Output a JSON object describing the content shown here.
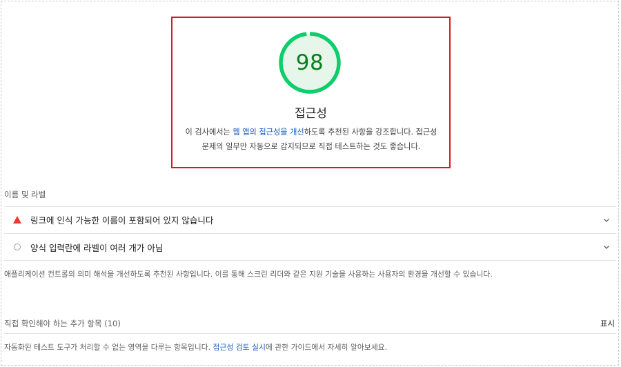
{
  "score": {
    "value": "98",
    "fraction": 0.98,
    "colors": {
      "ring": "#0cce6b",
      "fill": "#e6f6ea",
      "text": "#08801f"
    }
  },
  "category": {
    "title": "접근성",
    "description_prefix": "이 검사에서는 ",
    "description_link": "웹 앱의 접근성을 개선",
    "description_suffix": "하도록 추천된 사항을 강조합니다. 접근성 문제의 일부만 자동으로 감지되므로 직접 테스트하는 것도 좋습니다."
  },
  "group": {
    "label": "이름 및 라벨",
    "audits": [
      {
        "icon": "fail-triangle-icon",
        "text": "링크에 인식 가능한 이름이 포함되어 있지 않습니다"
      },
      {
        "icon": "neutral-circle-icon",
        "text": "양식 입력란에 라벨이 여러 개가 아님"
      }
    ],
    "description": "애플리케이션 컨트롤의 의미 해석을 개선하도록 추천된 사항입니다. 이를 통해 스크린 리더와 같은 지원 기술을 사용하는 사용자의 환경을 개선할 수 있습니다."
  },
  "manual": {
    "title": "직접 확인해야 하는 추가 항목 (10)",
    "toggle": "표시",
    "desc_prefix": "자동화된 테스트 도구가 처리할 수 없는 영역을 다루는 항목입니다. ",
    "desc_link": "접근성 검토 실시",
    "desc_suffix": "에 관한 가이드에서 자세히 알아보세요."
  },
  "highlight_color": "#d51a1a"
}
